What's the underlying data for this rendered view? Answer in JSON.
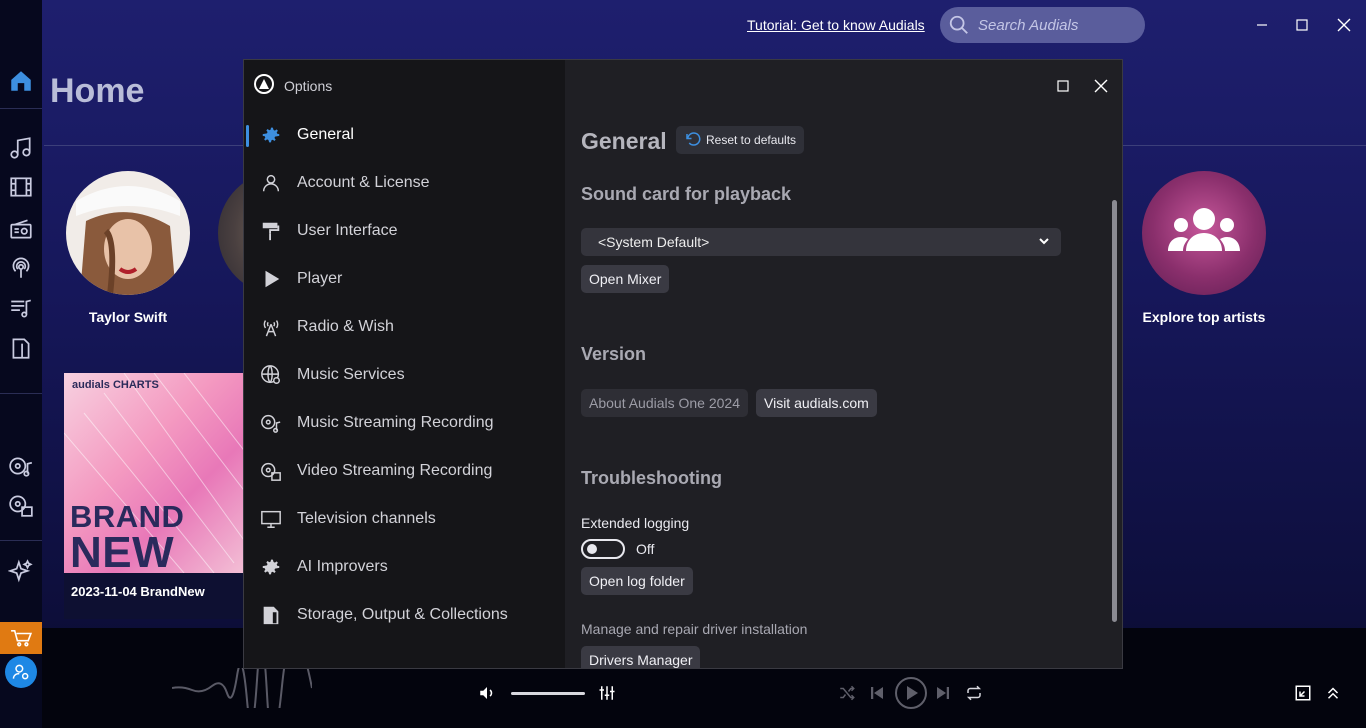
{
  "topbar": {
    "tutorial_link": "Tutorial: Get to know Audials",
    "search_placeholder": "Search Audials"
  },
  "home": {
    "title": "Home",
    "artists": [
      {
        "name": "Taylor Swift"
      },
      {
        "name": "Explore top artists"
      }
    ],
    "charts_tile": {
      "brand": "audials CHARTS",
      "headline_line1": "BRAND",
      "headline_line2": "NEW",
      "caption": "2023-11-04 BrandNew"
    }
  },
  "options": {
    "window_title": "Options",
    "nav": [
      {
        "label": "General",
        "icon": "gear-icon",
        "active": true
      },
      {
        "label": "Account & License",
        "icon": "user-icon"
      },
      {
        "label": "User Interface",
        "icon": "paint-roller-icon"
      },
      {
        "label": "Player",
        "icon": "play-icon"
      },
      {
        "label": "Radio & Wish",
        "icon": "radio-tower-icon"
      },
      {
        "label": "Music Services",
        "icon": "globe-icon"
      },
      {
        "label": "Music Streaming Recording",
        "icon": "record-music-icon"
      },
      {
        "label": "Video Streaming Recording",
        "icon": "record-video-icon"
      },
      {
        "label": "Television channels",
        "icon": "monitor-icon"
      },
      {
        "label": "AI Improvers",
        "icon": "gear-icon"
      },
      {
        "label": "Storage, Output & Collections",
        "icon": "storage-icon"
      }
    ],
    "content": {
      "title": "General",
      "reset_label": "Reset to defaults",
      "sound_card_heading": "Sound card for playback",
      "sound_card_value": "<System Default>",
      "open_mixer": "Open Mixer",
      "version_heading": "Version",
      "about_label": "About Audials One 2024",
      "visit_label": "Visit audials.com",
      "troubleshooting_heading": "Troubleshooting",
      "extended_logging_label": "Extended logging",
      "extended_logging_state": "Off",
      "open_log_folder": "Open log folder",
      "driver_text": "Manage and repair driver installation",
      "drivers_manager": "Drivers Manager"
    }
  },
  "colors": {
    "accent": "#3d8fe0",
    "cart": "#e07a12",
    "user_button": "#1e88e5"
  }
}
